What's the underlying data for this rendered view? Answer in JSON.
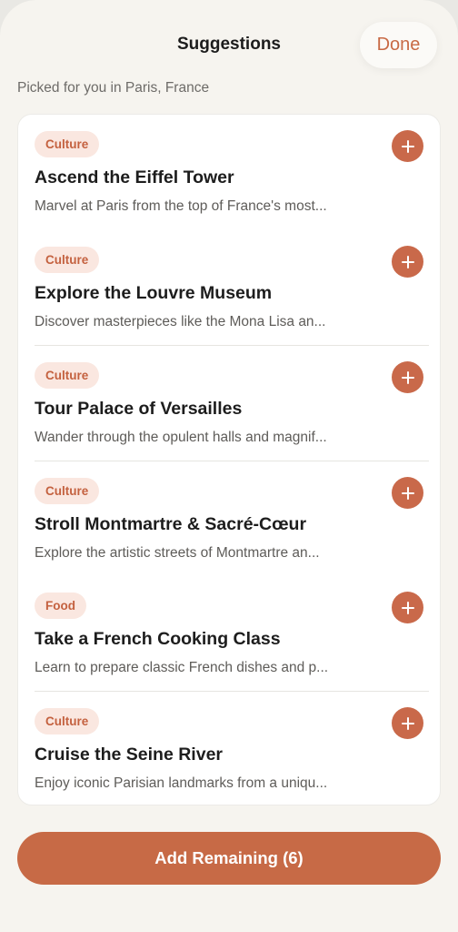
{
  "header": {
    "title": "Suggestions",
    "done_label": "Done"
  },
  "subtitle": "Picked for you in Paris, France",
  "suggestions": [
    {
      "tag": "Culture",
      "title": "Ascend the Eiffel Tower",
      "description": "Marvel at Paris from the top of France's most..."
    },
    {
      "tag": "Culture",
      "title": "Explore the Louvre Museum",
      "description": "Discover masterpieces like the Mona Lisa an..."
    },
    {
      "tag": "Culture",
      "title": "Tour Palace of Versailles",
      "description": "Wander through the opulent halls and magnif..."
    },
    {
      "tag": "Culture",
      "title": "Stroll Montmartre & Sacré-Cœur",
      "description": "Explore the artistic streets of Montmartre an..."
    },
    {
      "tag": "Food",
      "title": "Take a French Cooking Class",
      "description": "Learn to prepare classic French dishes and p..."
    },
    {
      "tag": "Culture",
      "title": "Cruise the Seine River",
      "description": "Enjoy iconic Parisian landmarks from a uniqu..."
    }
  ],
  "footer": {
    "add_remaining_label": "Add Remaining (6)"
  },
  "colors": {
    "accent": "#c9694a",
    "tag_bg": "#fae7e0",
    "background": "#f6f4ef"
  },
  "icons": {
    "add": "plus-icon"
  }
}
